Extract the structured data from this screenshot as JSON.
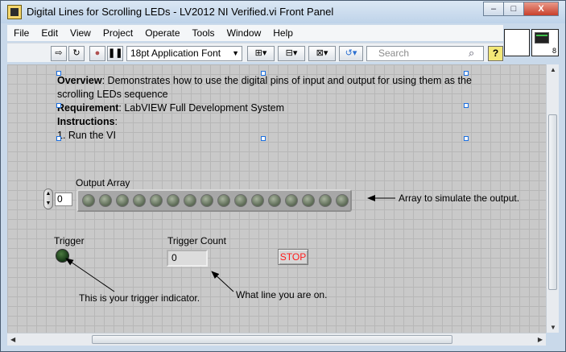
{
  "window": {
    "title": "Digital Lines for Scrolling LEDs - LV2012 NI Verified.vi Front Panel",
    "controls": {
      "minimize": "–",
      "maximize": "□",
      "close": "X"
    }
  },
  "menu": [
    "File",
    "Edit",
    "View",
    "Project",
    "Operate",
    "Tools",
    "Window",
    "Help"
  ],
  "toolbar": {
    "run_icon": "run-arrow-icon",
    "font_select": "18pt Application Font",
    "search_placeholder": "Search",
    "help_label": "?"
  },
  "vi_icon": {
    "instance_number": "8"
  },
  "documentation": {
    "overview_label": "Overview",
    "overview_text": ": Demonstrates how to use the digital pins of input and output for using them as the scrolling LEDs sequence",
    "requirement_label": "Requirement",
    "requirement_text": ": LabVIEW Full Development System",
    "instructions_label": "Instructions",
    "instructions_suffix": ":",
    "step_1": "1. Run the VI"
  },
  "output_array": {
    "label": "Output Array",
    "index_value": "0",
    "led_count": 16,
    "annotation": "Array to simulate the output."
  },
  "trigger": {
    "label": "Trigger",
    "annotation": "This is your trigger indicator."
  },
  "trigger_count": {
    "label": "Trigger Count",
    "value": "0",
    "annotation": "What line you are on."
  },
  "stop_button": {
    "label": "STOP"
  },
  "colors": {
    "panel_grid": "#c9c9c9",
    "stop_text": "#ff1b1b",
    "selection_handle": "#1b6fe0"
  }
}
